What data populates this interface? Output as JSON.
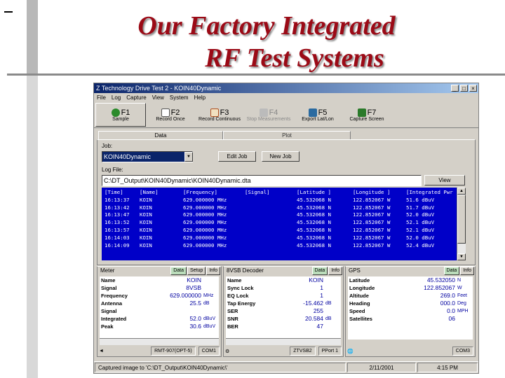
{
  "slide": {
    "title_line1": "Our Factory Integrated",
    "title_line2": "RF Test Systems"
  },
  "window": {
    "title": "Z Technology Drive Test 2 - KOIN40Dynamic",
    "controls": [
      "_",
      "□",
      "×"
    ],
    "menu": [
      "File",
      "Log",
      "Capture",
      "View",
      "System",
      "Help"
    ]
  },
  "toolbar": [
    {
      "key": "F1",
      "label": "Sample",
      "icon": "sample-icon",
      "color": "#2a8a2a"
    },
    {
      "key": "F2",
      "label": "Record Once",
      "icon": "record-once-icon",
      "color": "#555555"
    },
    {
      "key": "F3",
      "label": "Record Continuous",
      "icon": "record-continuous-icon",
      "color": "#b05020"
    },
    {
      "key": "F4",
      "label": "Stop Measurements",
      "icon": "stop-icon",
      "color": "#999999"
    },
    {
      "key": "F5",
      "label": "Export Lat/Lon",
      "icon": "export-icon",
      "color": "#2a6aa0"
    },
    {
      "key": "F7",
      "label": "Capture Screen",
      "icon": "camera-icon",
      "color": "#2a7a2a"
    }
  ],
  "tabs": [
    "Data",
    "Plot"
  ],
  "job": {
    "label": "Job:",
    "value": "KOIN40Dynamic",
    "edit_label": "Edit Job",
    "new_label": "New Job"
  },
  "log": {
    "label": "Log File:",
    "path": "C:\\DT_Output\\KOIN40Dynamic\\KOIN40Dynamic.dta",
    "view_label": "View",
    "headers": [
      "[Time]",
      "[Name]",
      "[Frequency]",
      "[Signal]",
      "[Latitude   ]",
      "[Longitude   ]",
      "[Integrated Pwr"
    ],
    "rows": [
      [
        "16:13:37",
        "KOIN",
        "629.000000 MHz",
        "",
        "45.532068 N",
        "122.852067 W",
        "51.6 dBuV"
      ],
      [
        "16:13:42",
        "KOIN",
        "629.000000 MHz",
        "",
        "45.532068 N",
        "122.852067 W",
        "51.7 dBuV"
      ],
      [
        "16:13:47",
        "KOIN",
        "629.000000 MHz",
        "",
        "45.532068 N",
        "122.852067 W",
        "52.0 dBuV"
      ],
      [
        "16:13:52",
        "KOIN",
        "629.000000 MHz",
        "",
        "45.532068 N",
        "122.852067 W",
        "52.1 dBuV"
      ],
      [
        "16:13:57",
        "KOIN",
        "629.000000 MHz",
        "",
        "45.532068 N",
        "122.852067 W",
        "52.1 dBuV"
      ],
      [
        "16:14:03",
        "KOIN",
        "629.000000 MHz",
        "",
        "45.532068 N",
        "122.852067 W",
        "52.0 dBuV"
      ],
      [
        "16:14:09",
        "KOIN",
        "629.000000 MHz",
        "",
        "45.532068 N",
        "122.852067 W",
        "52.4 dBuV"
      ]
    ]
  },
  "meter": {
    "title": "Meter",
    "btn_data": "Data",
    "btn_setup": "Setup",
    "btn_info": "Info",
    "rows": [
      {
        "k": "Name",
        "v": "KOIN",
        "u": ""
      },
      {
        "k": "Signal",
        "v": "8VSB",
        "u": ""
      },
      {
        "k": "Frequency",
        "v": "629.000000",
        "u": "MHz"
      },
      {
        "k": "Antenna",
        "v": "25.5",
        "u": "dB"
      },
      {
        "k": "Signal",
        "v": "",
        "u": ""
      },
      {
        "k": "Integrated",
        "v": "52.0",
        "u": "dBuV"
      },
      {
        "k": "Peak",
        "v": "30.6",
        "u": "dBuV"
      }
    ],
    "foot": [
      "RMT-907(OPT-5)",
      "COM1"
    ]
  },
  "decoder": {
    "title": "8VSB Decoder",
    "btn_data": "Data",
    "btn_info": "Info",
    "rows": [
      {
        "k": "Name",
        "v": "KOIN",
        "u": ""
      },
      {
        "k": "Sync Lock",
        "v": "1",
        "u": ""
      },
      {
        "k": "EQ Lock",
        "v": "1",
        "u": ""
      },
      {
        "k": "Tap Energy",
        "v": "-15.462",
        "u": "dB"
      },
      {
        "k": "SER",
        "v": "255",
        "u": ""
      },
      {
        "k": "SNR",
        "v": "20.584",
        "u": "dB"
      },
      {
        "k": "BER",
        "v": "47",
        "u": ""
      }
    ],
    "foot": [
      "ZTVSB2",
      "PPort 1"
    ]
  },
  "gps": {
    "title": "GPS",
    "btn_data": "Data",
    "btn_info": "Info",
    "rows": [
      {
        "k": "Latitude",
        "v": "45.532050",
        "u": "N"
      },
      {
        "k": "Longitude",
        "v": "122.852067",
        "u": "W"
      },
      {
        "k": "Altitude",
        "v": "269.0",
        "u": "Feet"
      },
      {
        "k": "Heading",
        "v": "000.0",
        "u": "Deg"
      },
      {
        "k": "Speed",
        "v": "0.0",
        "u": "MPH"
      },
      {
        "k": "Satellites",
        "v": "06",
        "u": ""
      }
    ],
    "foot": [
      "COM3"
    ]
  },
  "status": {
    "message": "Captured image to 'C:\\DT_Output\\KOIN40Dynamic\\'",
    "date": "2/11/2001",
    "time": "4:15 PM"
  }
}
